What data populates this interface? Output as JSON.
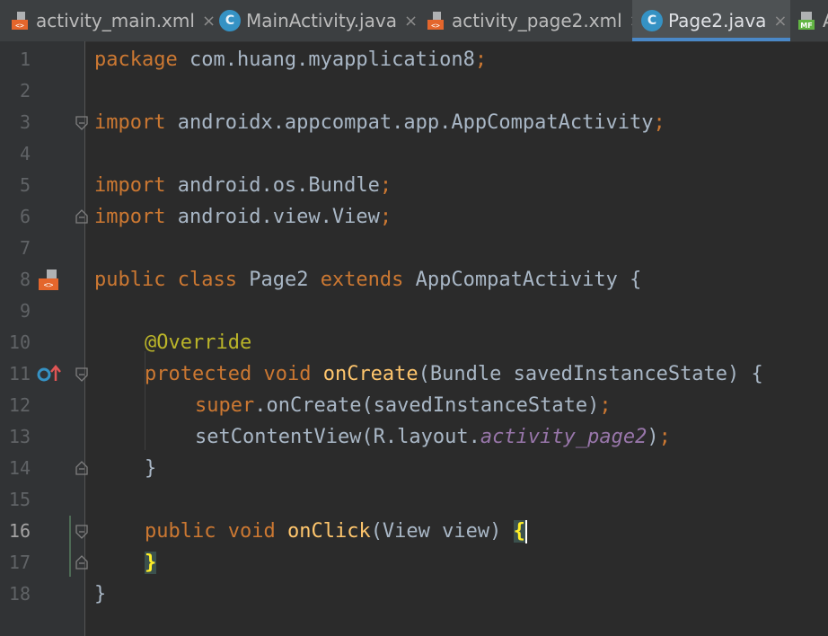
{
  "tabs": [
    {
      "label": "activity_main.xml",
      "icon": "xml-layout-icon",
      "active": false
    },
    {
      "label": "MainActivity.java",
      "icon": "java-class-icon",
      "active": false
    },
    {
      "label": "activity_page2.xml",
      "icon": "xml-layout-icon",
      "active": false
    },
    {
      "label": "Page2.java",
      "icon": "java-class-icon",
      "active": true
    },
    {
      "label": "A",
      "icon": "manifest-icon",
      "active": false
    }
  ],
  "close_glyph": "×",
  "line_numbers": [
    "1",
    "2",
    "3",
    "4",
    "5",
    "6",
    "7",
    "8",
    "9",
    "10",
    "11",
    "12",
    "13",
    "14",
    "15",
    "16",
    "17",
    "18"
  ],
  "current_line": "16",
  "code": {
    "l1": {
      "kw": "package",
      "rest": " com.huang.myapplication8",
      "semi": ";"
    },
    "l3": {
      "kw": "import",
      "rest": " androidx.appcompat.app.AppCompatActivity",
      "semi": ";"
    },
    "l5": {
      "kw": "import",
      "rest": " android.os.Bundle",
      "semi": ";"
    },
    "l6": {
      "kw": "import",
      "rest": " android.view.View",
      "semi": ";"
    },
    "l8": {
      "kw1": "public",
      "kw2": "class",
      "name": " Page2 ",
      "kw3": "extends",
      "rest": " AppCompatActivity {"
    },
    "l10": {
      "annotation": "@Override"
    },
    "l11": {
      "kw1": "protected",
      "kw2": "void",
      "method": "onCreate",
      "rest": "(Bundle savedInstanceState) {"
    },
    "l12": {
      "kw": "super",
      "rest": ".onCreate(savedInstanceState)",
      "semi": ";"
    },
    "l13": {
      "pre": "setContentView(R.layout.",
      "field": "activity_page2",
      "post": ")",
      "semi": ";"
    },
    "l14": {
      "text": "}"
    },
    "l16": {
      "kw1": "public",
      "kw2": "void",
      "method": "onClick",
      "rest": "(View view) ",
      "brace": "{"
    },
    "l17": {
      "brace": "}"
    },
    "l18": {
      "text": "}"
    }
  },
  "colors": {
    "background": "#2b2b2b",
    "keyword": "#cc7832",
    "plain": "#a9b7c6",
    "annotation": "#bbb529",
    "method": "#ffc66d",
    "field": "#9876aa",
    "accent": "#4a88c7"
  }
}
